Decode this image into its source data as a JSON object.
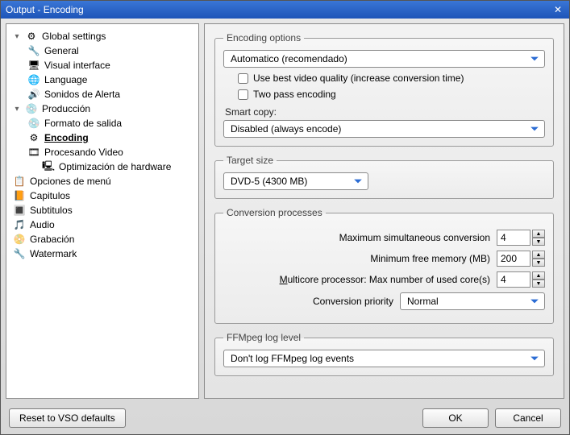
{
  "window": {
    "title": "Output - Encoding"
  },
  "tree": {
    "global": {
      "label": "Global settings"
    },
    "general": {
      "label": "General"
    },
    "visual": {
      "label": "Visual interface"
    },
    "language": {
      "label": "Language"
    },
    "sounds": {
      "label": "Sonidos de Alerta"
    },
    "production": {
      "label": "Producción"
    },
    "format": {
      "label": "Formato de salida"
    },
    "encoding": {
      "label": "Encoding"
    },
    "processing": {
      "label": "Procesando Video"
    },
    "hwopt": {
      "label": "Optimización de hardware"
    },
    "menuopts": {
      "label": "Opciones de menú"
    },
    "chapters": {
      "label": "Capitulos"
    },
    "subtitles": {
      "label": "Subtitulos"
    },
    "audio": {
      "label": "Audio"
    },
    "recording": {
      "label": "Grabación"
    },
    "watermark": {
      "label": "Watermark"
    }
  },
  "encoding_options": {
    "legend": "Encoding options",
    "preset": "Automatico (recomendado)",
    "best_quality_label": "Use best video quality (increase conversion time)",
    "best_quality_checked": false,
    "two_pass_label": "Two pass encoding",
    "two_pass_checked": false,
    "smart_copy_label": "Smart copy:",
    "smart_copy_value": "Disabled (always encode)"
  },
  "target_size": {
    "legend": "Target size",
    "value": "DVD-5 (4300 MB)"
  },
  "conversion": {
    "legend": "Conversion processes",
    "max_sim_label": "Maximum simultaneous conversion",
    "max_sim_value": "4",
    "min_mem_label": "Minimum free memory (MB)",
    "min_mem_value": "200",
    "multicore_label_pre": "M",
    "multicore_label_rest": "ulticore processor: Max number of used core(s)",
    "multicore_value": "4",
    "priority_label": "Conversion priority",
    "priority_value": "Normal"
  },
  "ffmpeg": {
    "legend": "FFMpeg log level",
    "value": "Don't log FFMpeg log events"
  },
  "footer": {
    "reset": "Reset to VSO defaults",
    "ok": "OK",
    "cancel": "Cancel"
  },
  "icons": {
    "gear": "⚙",
    "wrench": "🔧",
    "monitor": "🖥",
    "globe": "🌐",
    "speaker": "🔊",
    "disc": "💿",
    "film": "🎞",
    "cpu": "🖳",
    "menu": "📋",
    "book": "📙",
    "subs": "🔳",
    "note": "🎵",
    "camera": "📀",
    "mark": "🔧"
  }
}
